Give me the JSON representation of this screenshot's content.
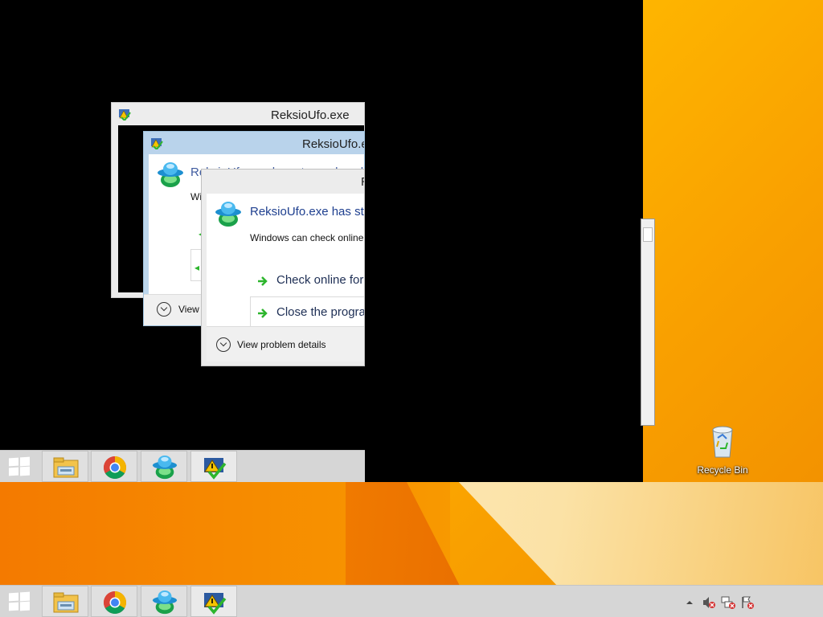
{
  "desktop": {
    "recycle_bin_label": "Recycle Bin",
    "wallpaper_colors": [
      "#ffb900",
      "#f47a00",
      "#fde7b4"
    ]
  },
  "dialogs": {
    "back": {
      "title": "ReksioUfo.exe"
    },
    "middle": {
      "title": "ReksioUfo.exe",
      "headline_fragment": "ReksioUfo.exe has stopped working",
      "sub_fragment": "Wi",
      "details_fragment": "View"
    },
    "front": {
      "title_fragment": "R",
      "headline": "ReksioUfo.exe has sto",
      "subtext": "Windows can check online",
      "option_check": "Check online for",
      "option_close": "Close the progra",
      "details": "View problem details"
    }
  },
  "taskbar": {
    "items": [
      "start",
      "file-explorer",
      "google-chrome",
      "reksio-ufo",
      "action-center"
    ],
    "tray": [
      "show-hidden-icons",
      "volume-muted",
      "network-disconnected",
      "action-center-flag"
    ]
  },
  "colors": {
    "taskbar_bg": "#d6d6d6",
    "headline_blue": "#1e3f8f",
    "arrow_green": "#2db52d"
  }
}
